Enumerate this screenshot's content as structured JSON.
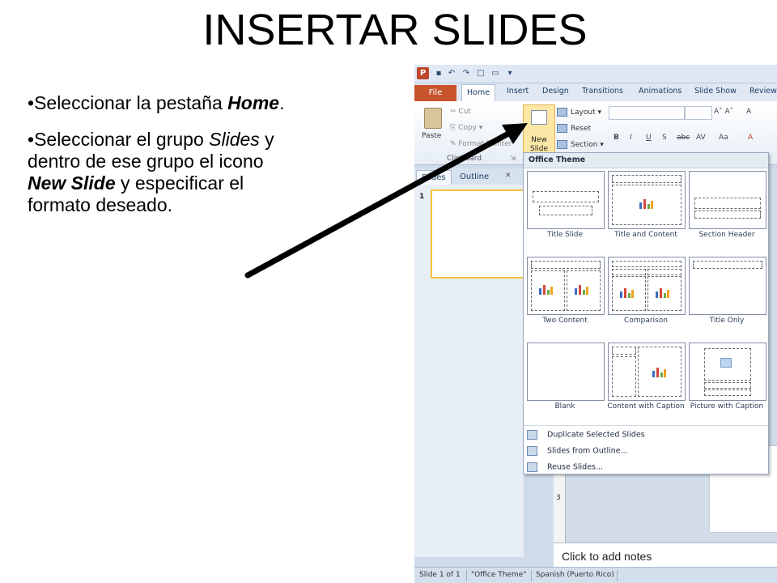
{
  "slide": {
    "title": "INSERTAR SLIDES",
    "bullets": [
      {
        "bullet": "•",
        "before": "Seleccionar la pestaña ",
        "em": "Home",
        "after": "."
      },
      {
        "bullet": "•",
        "before": "Seleccionar el grupo ",
        "em1": "Slides",
        "mid": " y dentro de ese grupo el icono ",
        "em2": "New Slide",
        "after": " y especificar el formato deseado."
      }
    ]
  },
  "app": {
    "quick_access": {
      "app_icon": "P"
    },
    "tabs": [
      "File",
      "Home",
      "Insert",
      "Design",
      "Transitions",
      "Animations",
      "Slide Show",
      "Review"
    ],
    "active_tab": "Home",
    "ribbon": {
      "paste": "Paste",
      "cut": "Cut",
      "copy": "Copy",
      "format_painter": "Format Painter",
      "clipboard_group": "Clipboard",
      "new_slide": "New Slide",
      "layout": "Layout",
      "reset": "Reset",
      "section": "Section"
    },
    "panel_tabs": [
      "Slides",
      "Outline"
    ],
    "slide_number": "1",
    "gallery": {
      "header": "Office Theme",
      "layouts": [
        "Title Slide",
        "Title and Content",
        "Section Header",
        "Two Content",
        "Comparison",
        "Title Only",
        "Blank",
        "Content with Caption",
        "Picture with Caption"
      ],
      "menu": [
        "Duplicate Selected Slides",
        "Slides from Outline...",
        "Reuse Slides..."
      ]
    },
    "notes_placeholder": "Click to add notes",
    "status": {
      "slide_count": "Slide 1 of 1",
      "theme": "\"Office Theme\"",
      "language": "Spanish (Puerto Rico)"
    },
    "ruler_numbers": [
      "3"
    ]
  },
  "colors": {
    "file_tab": "#c8542c",
    "arrow": "#000000",
    "selection": "#fde7a6"
  }
}
